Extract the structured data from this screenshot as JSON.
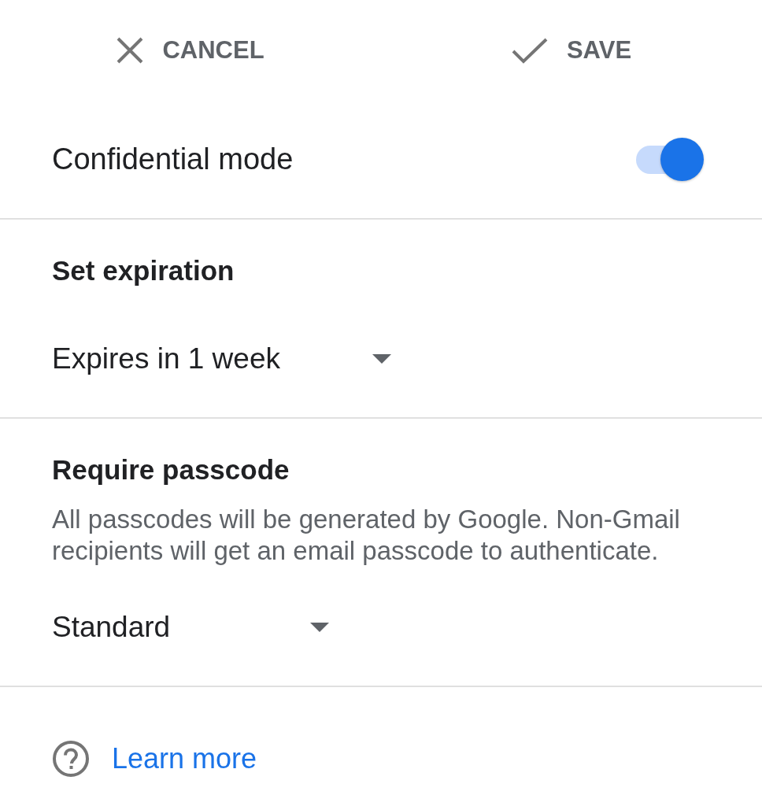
{
  "top_bar": {
    "cancel_button": {
      "label": "CANCEL"
    },
    "save_button": {
      "label": "SAVE"
    }
  },
  "confidential_mode": {
    "label": "Confidential mode",
    "on": true
  },
  "expiration": {
    "heading": "Set expiration",
    "dropdown": {
      "value": "Expires in 1 week"
    }
  },
  "passcode": {
    "heading": "Require passcode",
    "description": "All passcodes will be generated by Google. Non-Gmail recipients will get an email passcode to authenticate.",
    "dropdown": {
      "value": "Standard"
    }
  },
  "footer": {
    "link": "Learn more"
  }
}
